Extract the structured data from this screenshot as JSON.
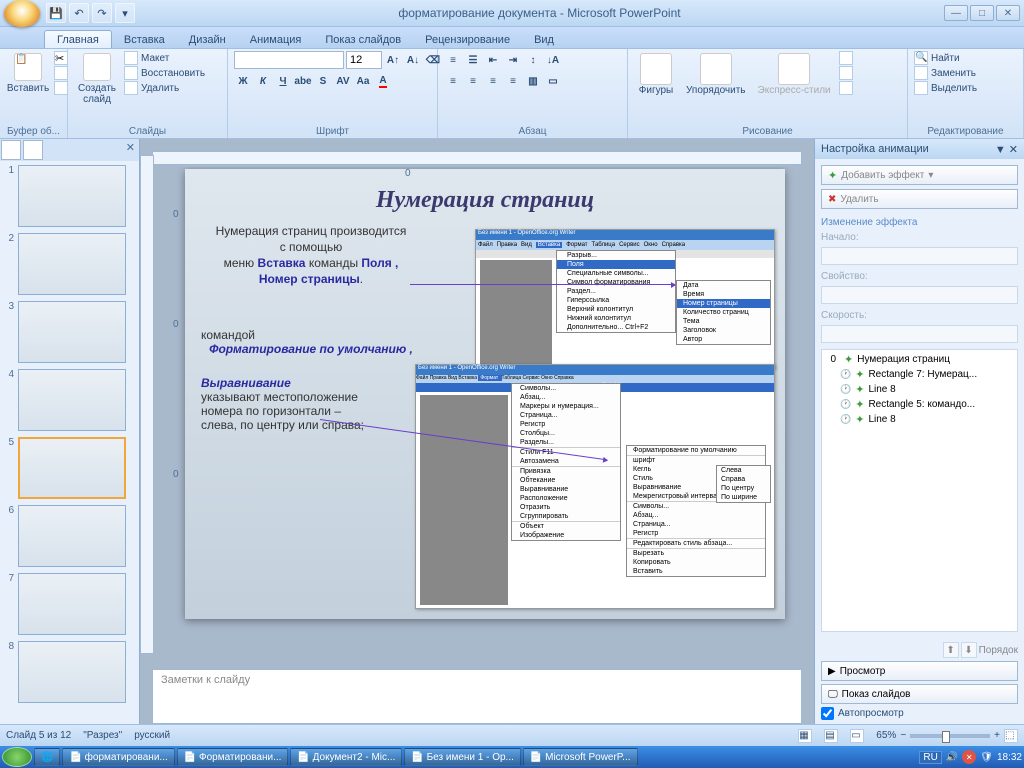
{
  "title": "форматирование документа - Microsoft PowerPoint",
  "tabs": [
    "Главная",
    "Вставка",
    "Дизайн",
    "Анимация",
    "Показ слайдов",
    "Рецензирование",
    "Вид"
  ],
  "active_tab": 0,
  "groups": {
    "clipboard": {
      "label": "Буфер об...",
      "paste": "Вставить"
    },
    "slides": {
      "label": "Слайды",
      "new": "Создать\nслайд",
      "layout": "Макет",
      "restore": "Восстановить",
      "delete": "Удалить"
    },
    "font": {
      "label": "Шрифт",
      "size": "12"
    },
    "para": {
      "label": "Абзац"
    },
    "draw": {
      "label": "Рисование",
      "shapes": "Фигуры",
      "arrange": "Упорядочить",
      "styles": "Экспресс-стили"
    },
    "edit": {
      "label": "Редактирование",
      "find": "Найти",
      "replace": "Заменить",
      "select": "Выделить"
    }
  },
  "thumbs": {
    "count": 8,
    "selected": 5
  },
  "slide": {
    "title": "Нумерация страниц",
    "p1a": "Нумерация страниц производится",
    "p1b": "с помощью",
    "p2a": "меню",
    "p2b": "Вставка",
    "p2c": "команды",
    "p2d": "Поля ,",
    "p3": "Номер страницы",
    "p4": "командой",
    "p5": "Форматирование по умолчанию ,",
    "p6": "Выравнивание",
    "p7": "указывают местоположение номера по горизонтали – слева, по центру или справа;",
    "shot1": {
      "title": "Без имени 1 - OpenOffice.org Writer",
      "menubar": [
        "Файл",
        "Правка",
        "Вид",
        "Вставка",
        "Формат",
        "Таблица",
        "Сервис",
        "Окно",
        "Справка"
      ],
      "menu": [
        "Разрыв...",
        "Поля",
        "Специальные символы...",
        "Символ форматирования",
        "Раздел...",
        "Гиперссылка",
        "Верхний колонтитул",
        "Нижний колонтитул",
        "Дополнительно... Ctrl+F2"
      ],
      "submenu": [
        "Дата",
        "Время",
        "Номер страницы",
        "Количество страниц",
        "Тема",
        "Заголовок",
        "Автор"
      ],
      "hl": "Поля",
      "hl2": "Номер страницы"
    },
    "shot2": {
      "title": "Без имени 1 - OpenOffice.org Writer",
      "menubar": [
        "Файл",
        "Правка",
        "Вид",
        "Вставка",
        "Формат",
        "Таблица",
        "Сервис",
        "Окно",
        "Справка"
      ],
      "top": "Форматирование по умолчанию  Ctrl+M",
      "menu": [
        "Символы...",
        "Абзац...",
        "Маркеры и нумерация...",
        "Страница...",
        "Регистр",
        "Столбцы...",
        "Разделы...",
        "",
        "Стили       F11",
        "Автозамена",
        "",
        "Привязка",
        "Обтекание",
        "Выравнивание",
        "Расположение",
        "Отразить",
        "Сгруппировать",
        "",
        "Объект",
        "Изображение"
      ],
      "submenu2": [
        "Форматирование по умолчанию",
        "",
        "шрифт",
        "Кегль",
        "Стиль",
        "Выравнивание",
        "Межрегистровый интервал",
        "",
        "Символы...",
        "Абзац...",
        "Страница...",
        "Регистр",
        "",
        "Редактировать стиль абзаца...",
        "",
        "Вырезать",
        "Копировать",
        "Вставить"
      ],
      "submenu3": [
        "Слева",
        "Справа",
        "По центру",
        "По ширине"
      ],
      "hl": "Выравнивание",
      "hl3": "Справа"
    }
  },
  "notes_placeholder": "Заметки к слайду",
  "anim": {
    "title": "Настройка анимации",
    "add": "Добавить эффект",
    "del": "Удалить",
    "change": "Изменение эффекта",
    "start": "Начало:",
    "prop": "Свойство:",
    "speed": "Скорость:",
    "items": [
      {
        "n": "0",
        "icon": "star",
        "label": "Нумерация страниц"
      },
      {
        "n": "",
        "icon": "clock",
        "label": "Rectangle 7: Нумерац..."
      },
      {
        "n": "",
        "icon": "clock",
        "label": "Line 8"
      },
      {
        "n": "",
        "icon": "clock",
        "label": "Rectangle 5:  командо..."
      },
      {
        "n": "",
        "icon": "clock",
        "label": "Line 8"
      }
    ],
    "order": "Порядок",
    "preview": "Просмотр",
    "slideshow": "Показ слайдов",
    "auto": "Автопросмотр"
  },
  "status": {
    "slide": "Слайд 5 из 12",
    "design": "\"Разрез\"",
    "lang": "русский",
    "zoom": "65%"
  },
  "taskbar": {
    "items": [
      "форматировани...",
      "Форматировани...",
      "Документ2 - Mic...",
      "Без имени 1 - Op...",
      "Microsoft PowerP..."
    ],
    "lang": "RU",
    "time": "18:32"
  }
}
